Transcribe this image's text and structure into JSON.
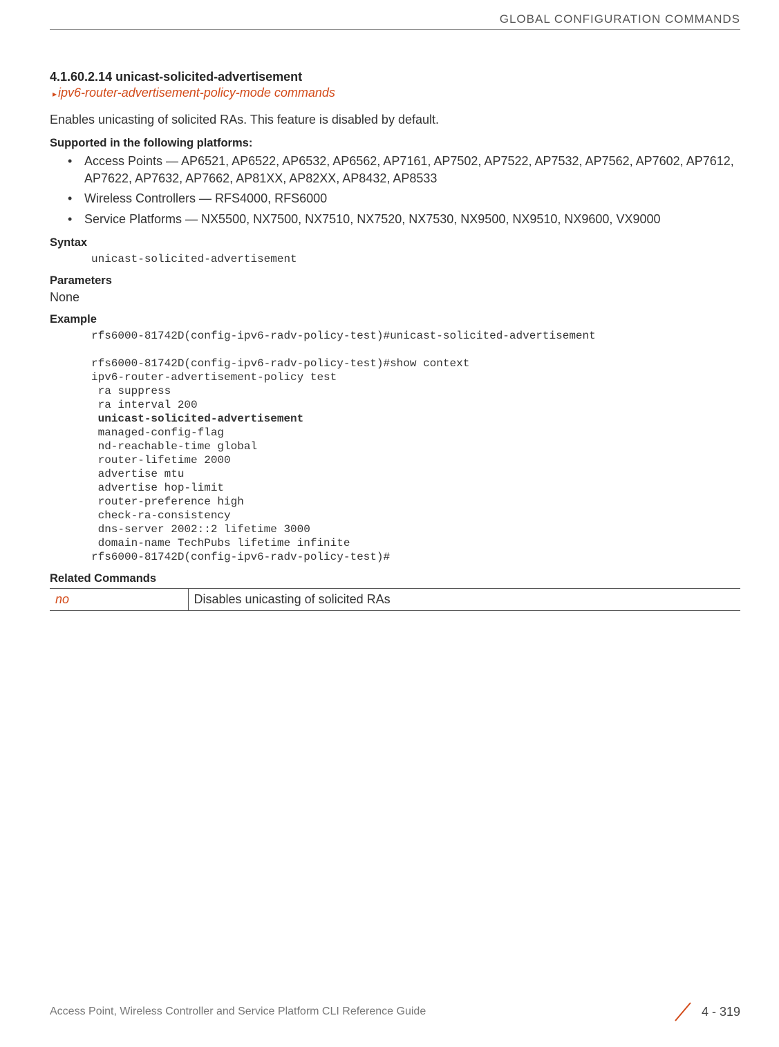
{
  "header": {
    "chapter_title": "GLOBAL CONFIGURATION COMMANDS"
  },
  "section": {
    "number_title": "4.1.60.2.14 unicast-solicited-advertisement",
    "subref": "ipv6-router-advertisement-policy-mode commands",
    "description": "Enables unicasting of solicited RAs. This feature is disabled by default."
  },
  "platforms": {
    "heading": "Supported in the following platforms:",
    "items": [
      "Access Points — AP6521, AP6522, AP6532, AP6562, AP7161, AP7502, AP7522, AP7532, AP7562, AP7602, AP7612, AP7622, AP7632, AP7662, AP81XX, AP82XX, AP8432, AP8533",
      "Wireless Controllers — RFS4000, RFS6000",
      "Service Platforms — NX5500, NX7500, NX7510, NX7520, NX7530, NX9500, NX9510, NX9600, VX9000"
    ]
  },
  "syntax": {
    "heading": "Syntax",
    "code": "unicast-solicited-advertisement"
  },
  "parameters": {
    "heading": "Parameters",
    "value": "None"
  },
  "example": {
    "heading": "Example",
    "line1": "rfs6000-81742D(config-ipv6-radv-policy-test)#unicast-solicited-advertisement",
    "blank1": "",
    "line2": "rfs6000-81742D(config-ipv6-radv-policy-test)#show context",
    "line3": "ipv6-router-advertisement-policy test",
    "line4": " ra suppress",
    "line5": " ra interval 200",
    "line6_prefix": " ",
    "line6_bold": "unicast-solicited-advertisement",
    "line7": " managed-config-flag",
    "line8": " nd-reachable-time global",
    "line9": " router-lifetime 2000",
    "line10": " advertise mtu",
    "line11": " advertise hop-limit",
    "line12": " router-preference high",
    "line13": " check-ra-consistency",
    "line14": " dns-server 2002::2 lifetime 3000",
    "line15": " domain-name TechPubs lifetime infinite",
    "line16": "rfs6000-81742D(config-ipv6-radv-policy-test)#"
  },
  "related": {
    "heading": "Related Commands",
    "rows": [
      {
        "cmd": "no",
        "desc": "Disables unicasting of solicited RAs"
      }
    ]
  },
  "footer": {
    "guide": "Access Point, Wireless Controller and Service Platform CLI Reference Guide",
    "page": "4 - 319"
  }
}
